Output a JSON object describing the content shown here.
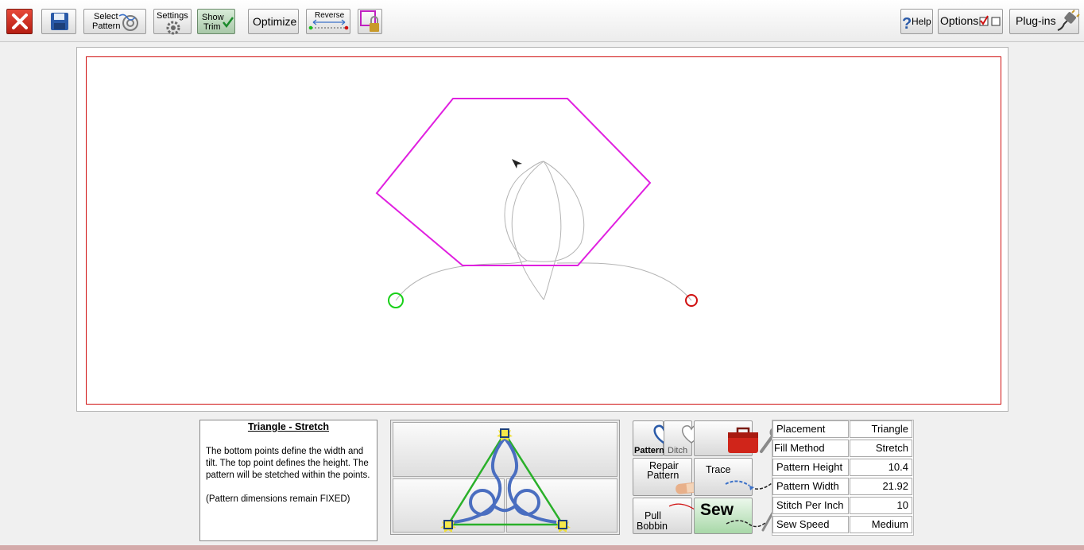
{
  "toolbar": {
    "select_pattern_line1": "Select",
    "select_pattern_line2": "Pattern",
    "settings": "Settings",
    "show_trim_line1": "Show",
    "show_trim_line2": "Trim",
    "optimize": "Optimize",
    "reverse": "Reverse",
    "help": "Help",
    "options": "Options",
    "plugins": "Plug-ins"
  },
  "canvas": {
    "boundary_color": "#d01010",
    "hexagon_color": "#e020e0",
    "stitch_color": "#b4b4b4",
    "start_marker_color": "#18d018",
    "end_marker_color": "#d01010"
  },
  "description": {
    "title": "Triangle - Stretch",
    "body": "The bottom points define the width and tilt. The top point defines the height. The pattern will be stetched within the points.",
    "note": "(Pattern dimensions remain FIXED)"
  },
  "actions": {
    "pattern": "Pattern",
    "ditch": "Ditch",
    "repair_line1": "Repair",
    "repair_line2": "Pattern",
    "trace": "Trace",
    "pull_line1": "Pull",
    "pull_line2": "Bobbin",
    "sew": "Sew"
  },
  "settings": [
    {
      "label": "Placement",
      "value": "Triangle"
    },
    {
      "label": "Fill Method",
      "value": "Stretch"
    },
    {
      "label": "Pattern Height",
      "value": "10.4"
    },
    {
      "label": "Pattern Width",
      "value": "21.92"
    },
    {
      "label": "Stitch Per Inch",
      "value": "10"
    },
    {
      "label": "Sew Speed",
      "value": "Medium"
    }
  ]
}
